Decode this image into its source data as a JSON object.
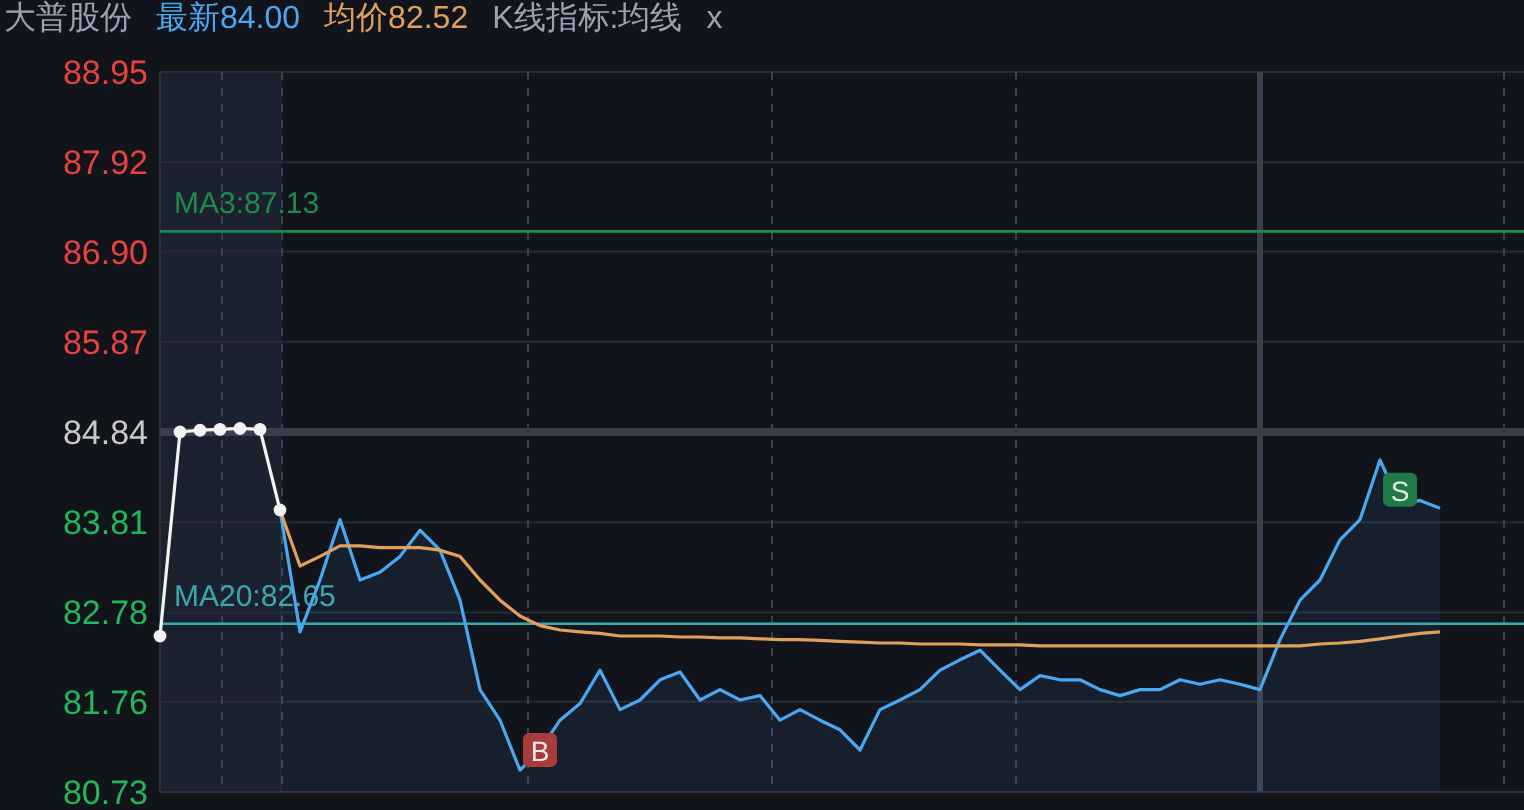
{
  "header": [
    {
      "text": "大普股份",
      "color": "#9aa3b5"
    },
    {
      "text": "最新84.00",
      "color": "#4aa8f0"
    },
    {
      "text": "均价82.52",
      "color": "#e0a25a"
    },
    {
      "text": "K线指标:均线",
      "color": "#9aa3b5"
    },
    {
      "text": "x",
      "color": "#9aa3b5"
    }
  ],
  "chart_data": {
    "type": "line",
    "grid": true,
    "ylim": [
      80.73,
      88.95
    ],
    "yticks": [
      {
        "value": 88.95,
        "label": "88.95"
      },
      {
        "value": 87.92,
        "label": "87.92"
      },
      {
        "value": 86.9,
        "label": "86.90"
      },
      {
        "value": 85.87,
        "label": "85.87"
      },
      {
        "value": 84.84,
        "label": "84.84"
      },
      {
        "value": 83.81,
        "label": "83.81"
      },
      {
        "value": 82.78,
        "label": "82.78"
      },
      {
        "value": 81.76,
        "label": "81.76"
      },
      {
        "value": 80.73,
        "label": "80.73"
      }
    ],
    "series": [
      {
        "color": "#4aa8f0",
        "type": "area",
        "values": [
          null,
          null,
          null,
          null,
          null,
          null,
          83.95,
          82.56,
          83.15,
          83.84,
          83.15,
          83.24,
          83.42,
          83.72,
          83.49,
          82.92,
          81.9,
          81.55,
          80.98,
          81.21,
          81.55,
          81.74,
          82.12,
          81.67,
          81.78,
          82.01,
          82.1,
          81.78,
          81.9,
          81.78,
          81.83,
          81.55,
          81.67,
          81.55,
          81.44,
          81.21,
          81.67,
          81.78,
          81.9,
          82.12,
          82.24,
          82.35,
          82.12,
          81.9,
          82.06,
          82.01,
          82.01,
          81.9,
          81.83,
          81.9,
          81.9,
          82.01,
          81.96,
          82.01,
          81.96,
          81.9,
          82.47,
          82.92,
          83.15,
          83.61,
          83.84,
          84.52,
          84.02,
          84.06,
          83.97
        ]
      },
      {
        "color": "#e0a25a",
        "type": "line",
        "values": [
          null,
          null,
          null,
          null,
          null,
          null,
          83.95,
          83.31,
          83.42,
          83.54,
          83.54,
          83.52,
          83.52,
          83.52,
          83.49,
          83.42,
          83.15,
          82.92,
          82.74,
          82.63,
          82.58,
          82.56,
          82.54,
          82.51,
          82.51,
          82.51,
          82.5,
          82.5,
          82.49,
          82.49,
          82.48,
          82.47,
          82.47,
          82.46,
          82.45,
          82.44,
          82.43,
          82.43,
          82.42,
          82.42,
          82.42,
          82.41,
          82.41,
          82.41,
          82.4,
          82.4,
          82.4,
          82.4,
          82.4,
          82.4,
          82.4,
          82.4,
          82.4,
          82.4,
          82.4,
          82.4,
          82.4,
          82.4,
          82.42,
          82.43,
          82.45,
          82.48,
          82.51,
          82.54,
          82.56
        ]
      },
      {
        "color": "#f2f2f2",
        "type": "line",
        "marker": "o",
        "values": [
          82.51,
          84.84,
          84.86,
          84.87,
          84.88,
          84.87,
          83.95
        ]
      }
    ],
    "ref_lines": [
      {
        "axis": "y",
        "value": 84.84,
        "color": "#3a3e4c"
      },
      {
        "axis": "y",
        "value": 87.13,
        "label": "MA3:87.13",
        "color": "#1f8a4c"
      },
      {
        "axis": "y",
        "value": 82.65,
        "label": "MA20:82.65",
        "color": "#3aa9ad"
      }
    ]
  },
  "signals": [
    {
      "text": "B",
      "kind": "buy"
    },
    {
      "text": "S",
      "kind": "sell"
    }
  ]
}
